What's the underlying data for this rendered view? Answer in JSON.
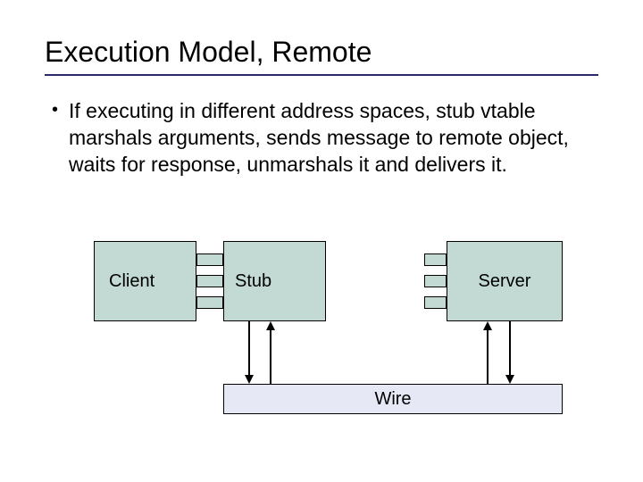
{
  "title": "Execution Model, Remote",
  "bullet": "If executing in different address spaces, stub vtable marshals arguments, sends message to remote object, waits for response, unmarshals it and delivers it.",
  "diagram": {
    "client": "Client",
    "stub": "Stub",
    "server": "Server",
    "wire": "Wire"
  }
}
